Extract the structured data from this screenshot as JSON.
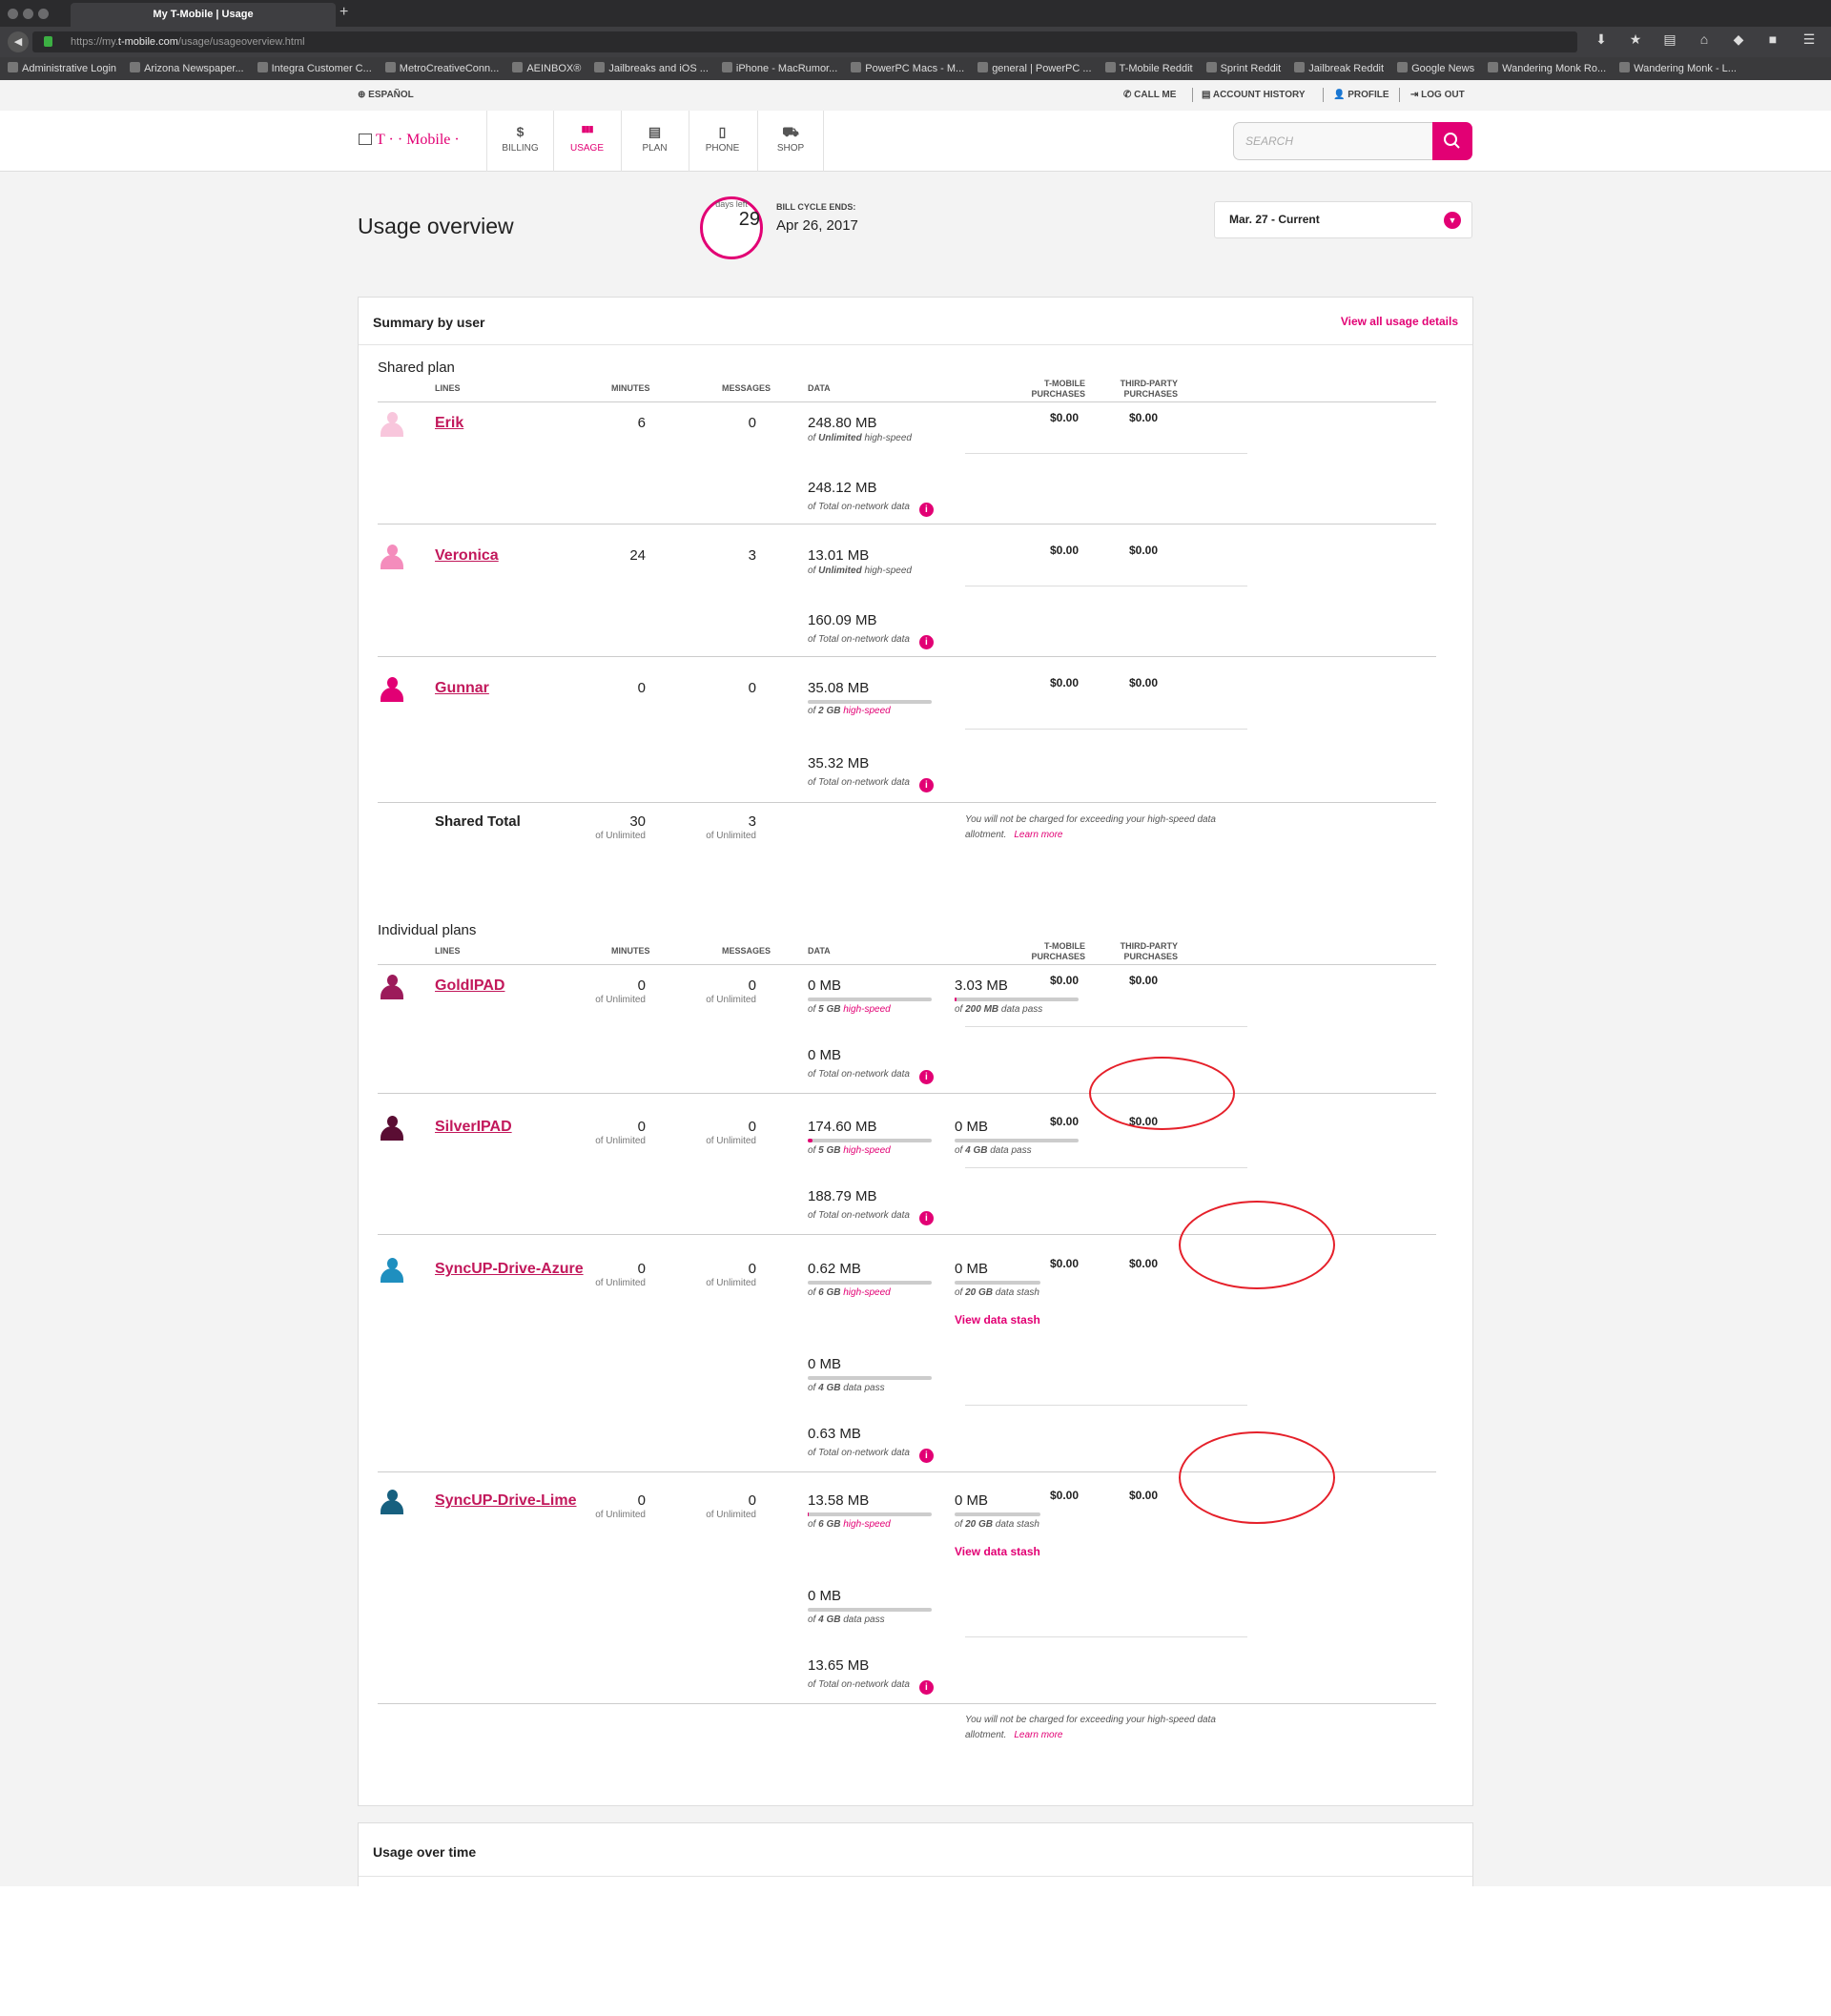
{
  "browser": {
    "tab_title": "My T-Mobile | Usage",
    "new_tab": "+",
    "url_prefix": "https://my.",
    "url_domain": "t-mobile.com",
    "url_path": "/usage/usageoverview.html",
    "bookmarks": [
      "Administrative Login",
      "Arizona Newspaper...",
      "Integra Customer C...",
      "MetroCreativeConn...",
      "AEINBOX®",
      "Jailbreaks and iOS ...",
      "iPhone - MacRumor...",
      "PowerPC Macs - M...",
      "general | PowerPC ...",
      "T-Mobile Reddit",
      "Sprint Reddit",
      "Jailbreak Reddit",
      "Google News",
      "Wandering Monk Ro...",
      "Wandering Monk - L..."
    ]
  },
  "utility": {
    "language": "ESPAÑOL",
    "call_me": "CALL ME",
    "account_history": "ACCOUNT HISTORY",
    "profile": "PROFILE",
    "log_out": "LOG OUT"
  },
  "header": {
    "logo": "T · · Mobile ·",
    "nav": [
      {
        "icon": "$",
        "label": "BILLING"
      },
      {
        "icon": "▮▮▮",
        "label": "USAGE"
      },
      {
        "icon": "▤",
        "label": "PLAN"
      },
      {
        "icon": "▯",
        "label": "PHONE"
      },
      {
        "icon": "⛟",
        "label": "SHOP"
      }
    ],
    "search_placeholder": "SEARCH"
  },
  "overview": {
    "title": "Usage overview",
    "days_left": "29",
    "days_left_label": "days left",
    "bill_cycle_label": "BILL CYCLE ENDS:",
    "bill_cycle_date": "Apr 26, 2017",
    "period": "Mar. 27 - Current"
  },
  "summary": {
    "title": "Summary by user",
    "view_all": "View all usage details",
    "shared_label": "Shared plan",
    "individual_label": "Individual plans",
    "columns": {
      "lines": "LINES",
      "minutes": "MINUTES",
      "messages": "MESSAGES",
      "data": "DATA",
      "tmobile": [
        "T-MOBILE",
        "PURCHASES"
      ],
      "third_party": [
        "THIRD-PARTY",
        "PURCHASES"
      ]
    },
    "of_unlimited": "of Unlimited",
    "shared_lines": [
      {
        "name": "Erik",
        "minutes": "6",
        "messages": "0",
        "d1": "248.80 MB",
        "d1_pre": "of ",
        "d1_bold": "Unlimited",
        "d1_hs": " high-speed",
        "d2": "248.12 MB",
        "d2_sub": "of Total on-network data",
        "tmobile": "$0.00",
        "third": "$0.00"
      },
      {
        "name": "Veronica",
        "minutes": "24",
        "messages": "3",
        "d1": "13.01 MB",
        "d1_pre": "of ",
        "d1_bold": "Unlimited",
        "d1_hs": " high-speed",
        "d2": "160.09 MB",
        "d2_sub": "of Total on-network data",
        "tmobile": "$0.00",
        "third": "$0.00"
      },
      {
        "name": "Gunnar",
        "minutes": "0",
        "messages": "0",
        "d1": "35.08 MB",
        "d1_pre": "of ",
        "d1_bold": "2 GB",
        "d1_hs": " high-speed",
        "d2": "35.32 MB",
        "d2_sub": "of Total on-network data",
        "tmobile": "$0.00",
        "third": "$0.00"
      }
    ],
    "shared_total": {
      "label": "Shared Total",
      "minutes": "30",
      "messages": "3"
    },
    "note": "You will not be charged for exceeding your high-speed data allotment.",
    "learn_more": "Learn more",
    "individual_lines": [
      {
        "name": "GoldIPAD",
        "minutes": "0",
        "messages": "0",
        "d1": "0 MB",
        "d1_bold": "5 GB",
        "d1_rest": " high-speed",
        "d1b": "3.03 MB",
        "d1b_bold": "200 MB",
        "d1b_rest": " data pass",
        "d2": "0 MB",
        "d2_sub": "of Total on-network data",
        "tmobile": "$0.00",
        "third": "$0.00"
      },
      {
        "name": "SilverIPAD",
        "minutes": "0",
        "messages": "0",
        "d1": "174.60 MB",
        "d1_bold": "5 GB",
        "d1_rest": " high-speed",
        "d1b": "0 MB",
        "d1b_bold": "4 GB",
        "d1b_rest": " data pass",
        "d2": "188.79 MB",
        "d2_sub": "of Total on-network data",
        "tmobile": "$0.00",
        "third": "$0.00"
      },
      {
        "name": "SyncUP-Drive-Azure",
        "minutes": "0",
        "messages": "0",
        "d1": "0.62 MB",
        "d1_bold": "6 GB",
        "d1_rest": " high-speed",
        "d1b": "0 MB",
        "d1b_bold": "20 GB",
        "d1b_rest": " data stash",
        "stash_link": "View data stash",
        "d3": "0 MB",
        "d3_bold": "4 GB",
        "d3_rest": " data pass",
        "d2": "0.63 MB",
        "d2_sub": "of Total on-network data",
        "tmobile": "$0.00",
        "third": "$0.00"
      },
      {
        "name": "SyncUP-Drive-Lime",
        "minutes": "0",
        "messages": "0",
        "d1": "13.58 MB",
        "d1_bold": "6 GB",
        "d1_rest": " high-speed",
        "d1b": "0 MB",
        "d1b_bold": "20 GB",
        "d1b_rest": " data stash",
        "stash_link": "View data stash",
        "d3": "0 MB",
        "d3_bold": "4 GB",
        "d3_rest": " data pass",
        "d2": "13.65 MB",
        "d2_sub": "of Total on-network data",
        "tmobile": "$0.00",
        "third": "$0.00"
      }
    ]
  },
  "usage_over_time": {
    "title": "Usage over time"
  },
  "colors": {
    "accent": "#e20074",
    "annotation": "#e5202a"
  },
  "avatar_colors": [
    "#f8c6dc",
    "#f48cbc",
    "#e20074",
    "#9c1a5a",
    "#5a0d33",
    "#1f8fbf",
    "#17607f"
  ]
}
